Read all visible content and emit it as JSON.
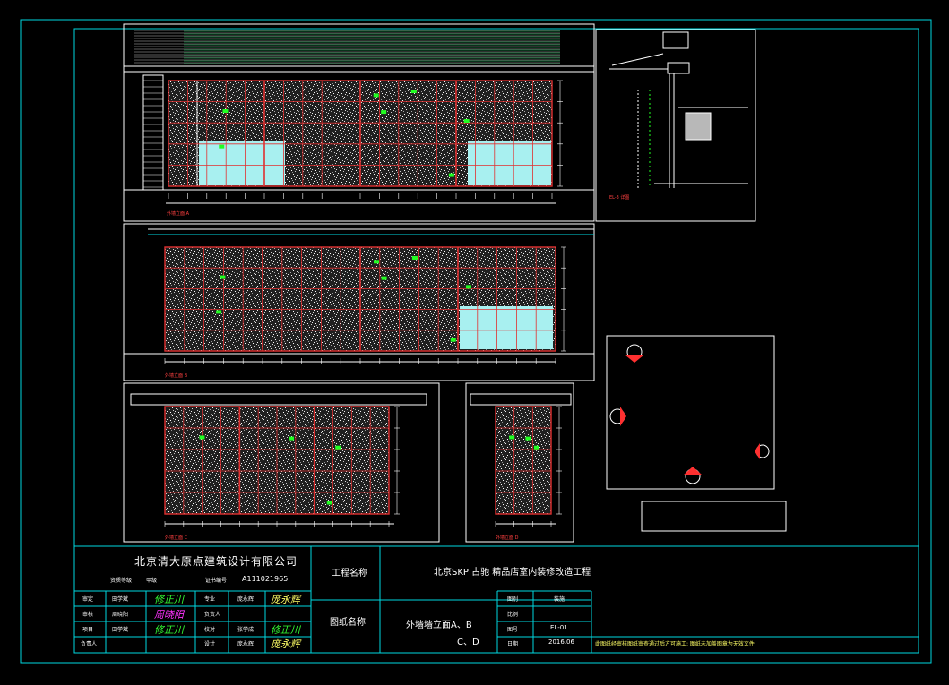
{
  "drawing": {
    "background": "#000000",
    "colors": {
      "frame": "#00d8e0",
      "outline": "#ffffff",
      "red": "#e03030",
      "green": "#22ff22",
      "glass": "#a8f0f0",
      "grey": "#bbbbbb"
    }
  },
  "title_block": {
    "company": "北京清大原点建筑设计有限公司",
    "qualification_label": "资质等级",
    "qualification_value": "甲级",
    "certificate_label": "证书编号",
    "certificate_value": "A111021965",
    "project_name_label": "工程名称",
    "project_name": "北京SKP 古驰 精品店室内装修改造工程",
    "drawing_name_label": "图纸名称",
    "drawing_name_line1": "外墙墙立面A、B",
    "drawing_name_line2": "C、D",
    "staff": [
      {
        "role": "审定",
        "name": "田学斌",
        "sig": "修正川"
      },
      {
        "role": "审核",
        "name": "周晓阳",
        "sig": "周晓阳"
      },
      {
        "role": "项目",
        "name": "田学斌",
        "sig": "修正川"
      },
      {
        "role": "负责人",
        "name": "",
        "sig": ""
      }
    ],
    "staff2": [
      {
        "role": "专业",
        "name": "庞永辉",
        "sig": "庞永辉"
      },
      {
        "role": "负责人",
        "name": "",
        "sig": ""
      },
      {
        "role": "校对",
        "name": "张学成",
        "sig": "修正川"
      },
      {
        "role": "设计",
        "name": "庞永辉",
        "sig": "庞永辉"
      }
    ],
    "info": [
      {
        "label": "图别",
        "value": "装施"
      },
      {
        "label": "比例",
        "value": ""
      },
      {
        "label": "图号",
        "value": "EL-01"
      },
      {
        "label": "日期",
        "value": "2016.06"
      }
    ],
    "note": "此图纸经审核图纸审查通过后方可施工: 图纸未加盖图章为无效文件"
  },
  "elevations": [
    {
      "id": "A",
      "tag": "外墙立面 A"
    },
    {
      "id": "B",
      "tag": "外墙立面 B"
    },
    {
      "id": "C",
      "tag": "外墙立面 C"
    },
    {
      "id": "D",
      "tag": "外墙立面 D"
    },
    {
      "id": "section",
      "tag": "EL-3 详图"
    }
  ]
}
